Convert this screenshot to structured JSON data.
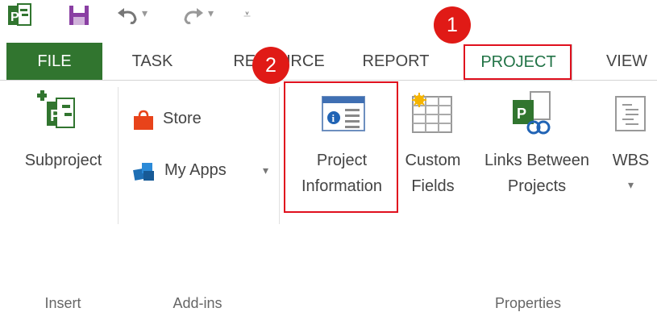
{
  "quick_access": {
    "app_icon": "project-logo-icon",
    "save_icon": "save-icon",
    "undo_icon": "undo-icon",
    "redo_icon": "redo-icon",
    "customize_icon": "customize-qat-icon"
  },
  "tabs": [
    {
      "label": "FILE"
    },
    {
      "label": "TASK"
    },
    {
      "label": "RESOURCE"
    },
    {
      "label": "REPORT"
    },
    {
      "label": "PROJECT"
    },
    {
      "label": "VIEW"
    }
  ],
  "ribbon": {
    "insert": {
      "group_label": "Insert",
      "subproject_label": "Subproject"
    },
    "addins": {
      "group_label": "Add-ins",
      "store_label": "Store",
      "myapps_label": "My Apps",
      "myapps_arrow": "▾"
    },
    "properties": {
      "group_label": "Properties",
      "project_info_line1": "Project",
      "project_info_line2": "Information",
      "custom_fields_line1": "Custom",
      "custom_fields_line2": "Fields",
      "links_line1": "Links Between",
      "links_line2": "Projects",
      "wbs_label": "WBS",
      "wbs_arrow": "▾"
    }
  },
  "annotations": [
    {
      "number": "1"
    },
    {
      "number": "2"
    }
  ],
  "colors": {
    "file_tab_bg": "#31752f",
    "project_green": "#217346",
    "highlight_red": "#e0101e"
  }
}
